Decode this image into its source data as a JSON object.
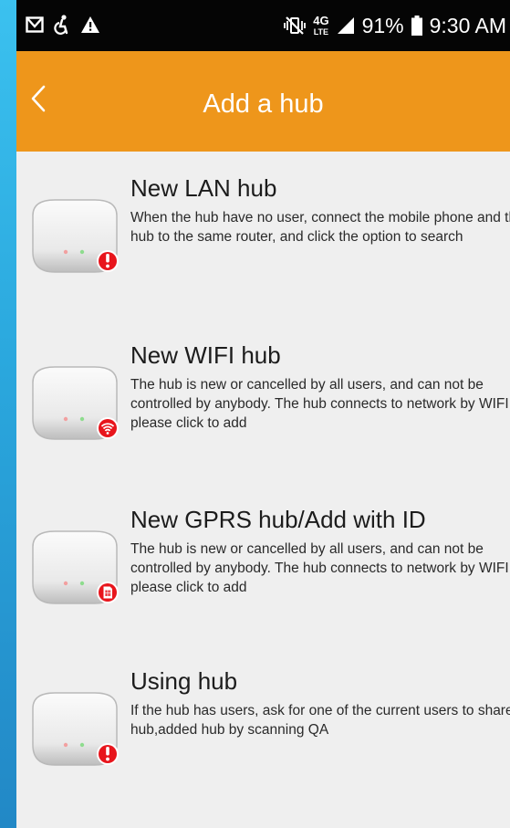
{
  "status_bar": {
    "left_icons": [
      "mail-icon",
      "accessibility-icon",
      "warning-icon"
    ],
    "right_icons": [
      "mute-vibrate-icon",
      "signal-4g-lte-icon",
      "cell-signal-icon",
      "battery-icon"
    ],
    "network_label": "4G",
    "network_sub_label": "LTE",
    "battery_percent": "91%",
    "time": "9:30 AM"
  },
  "header": {
    "back_icon": "chevron-left-icon",
    "title": "Add a hub",
    "color": "#ee961b"
  },
  "hubs": [
    {
      "title": "New LAN hub",
      "description": "When the hub have no user, connect the mobile phone and the hub to the same router, and click the option to search",
      "badge_icon": "exclamation-badge-icon"
    },
    {
      "title": "New WIFI hub",
      "description": "The hub is new or cancelled by all users, and can not be controlled by anybody. The hub connects to network by WIFI, please click to add",
      "badge_icon": "wifi-badge-icon"
    },
    {
      "title": "New GPRS hub/Add with ID",
      "description": "The hub is new or cancelled by all users, and can not be controlled by anybody. The hub connects to network by WIFI, please click to add",
      "badge_icon": "sim-card-badge-icon"
    },
    {
      "title": "Using hub",
      "description": "If the hub has users, ask for one of the current users to share hub,added hub by scanning QA",
      "badge_icon": "exclamation-badge-icon"
    }
  ],
  "colors": {
    "background": "#efefef",
    "status_bar": "#050505",
    "badge_red": "#e8151c"
  }
}
